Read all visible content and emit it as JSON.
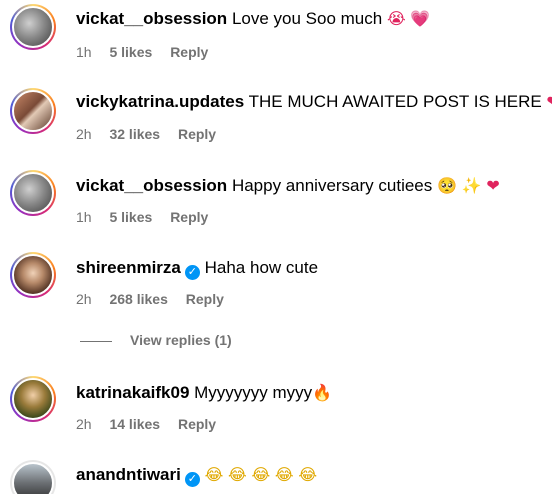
{
  "comments": [
    {
      "username": "vickat__obsession",
      "text": "Love you Soo much",
      "emojis": [
        {
          "name": "crying-face-emoji",
          "glyph": "😭"
        },
        {
          "name": "heart-emoji",
          "glyph": "💗"
        }
      ],
      "time": "1h",
      "likes": "5 likes",
      "reply": "Reply"
    },
    {
      "username": "vickykatrina.updates",
      "text": "THE MUCH AWAITED POST IS HERE",
      "emojis": [
        {
          "name": "heart-emoji",
          "glyph": "❤"
        }
      ],
      "time": "2h",
      "likes": "32 likes",
      "reply": "Reply"
    },
    {
      "username": "vickat__obsession",
      "text": "Happy anniversary cutiees",
      "emojis": [
        {
          "name": "pleading-face-emoji",
          "glyph": "🥺"
        },
        {
          "name": "sparkles-emoji",
          "glyph": "✨"
        },
        {
          "name": "heart-emoji",
          "glyph": "❤"
        }
      ],
      "time": "1h",
      "likes": "5 likes",
      "reply": "Reply"
    },
    {
      "username": "shireenmirza",
      "verified": true,
      "text": "Haha how cute",
      "emojis": [],
      "time": "2h",
      "likes": "268 likes",
      "reply": "Reply"
    },
    {
      "username": "katrinakaifk09",
      "text": "Myyyyyyy myyy",
      "emojis": [
        {
          "name": "fire-emoji",
          "glyph": "🔥"
        }
      ],
      "time": "2h",
      "likes": "14 likes",
      "reply": "Reply"
    },
    {
      "username": "anandntiwari",
      "verified": true,
      "text": "",
      "emojis": [
        {
          "name": "laughing-emoji",
          "glyph": "😂"
        },
        {
          "name": "laughing-emoji",
          "glyph": "😂"
        },
        {
          "name": "laughing-emoji",
          "glyph": "😂"
        },
        {
          "name": "laughing-emoji",
          "glyph": "😂"
        },
        {
          "name": "laughing-emoji",
          "glyph": "😂"
        }
      ]
    }
  ],
  "view_replies": "View replies (1)",
  "verified_glyph": "✓",
  "colors": {
    "meta": "#737373",
    "verified": "#0095f6",
    "heart": "#e0245e"
  }
}
